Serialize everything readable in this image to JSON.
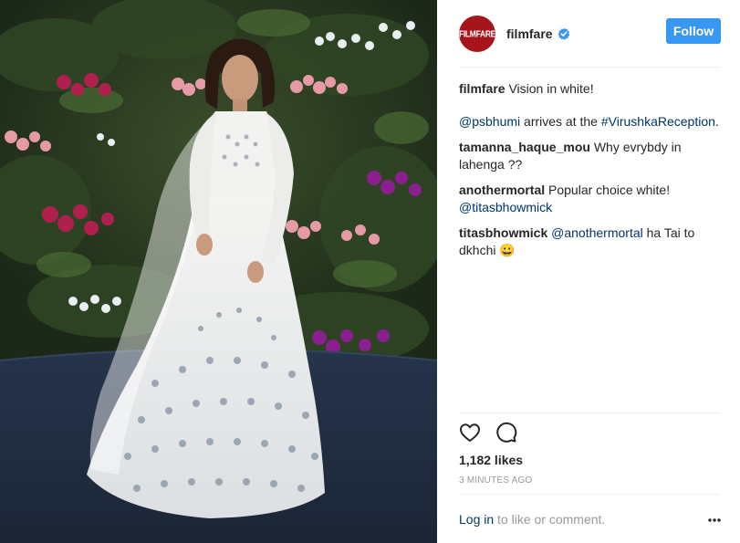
{
  "post": {
    "image_alt": "Woman in white embroidered lehenga posing in front of a floral wall"
  },
  "header": {
    "avatar_text": "FILMFARE",
    "username": "filmfare",
    "verified_icon": "verified-badge-icon",
    "follow_label": "Follow",
    "accent_color": "#3897f0"
  },
  "caption": {
    "user": "filmfare",
    "text": "Vision in white!",
    "mention": "@psbhumi",
    "mid_text": "arrives at the",
    "hashtag": "#VirushkaReception",
    "end_text": "."
  },
  "comments": [
    {
      "user": "tamanna_haque_mou",
      "text": "Why evrybdy in lahenga ??"
    },
    {
      "user": "anothermortal",
      "text": "Popular choice white!",
      "mention": "@titasbhowmick"
    },
    {
      "user": "titasbhowmick",
      "mention": "@anothermortal",
      "text": "ha Tai to dkhchi 😀"
    }
  ],
  "actions": {
    "like_icon": "heart-icon",
    "comment_icon": "comment-bubble-icon",
    "more_icon": "more-options-icon"
  },
  "likes": "1,182 likes",
  "timestamp": "3 MINUTES AGO",
  "footer": {
    "login_label": "Log in",
    "suffix": "to like or comment."
  }
}
